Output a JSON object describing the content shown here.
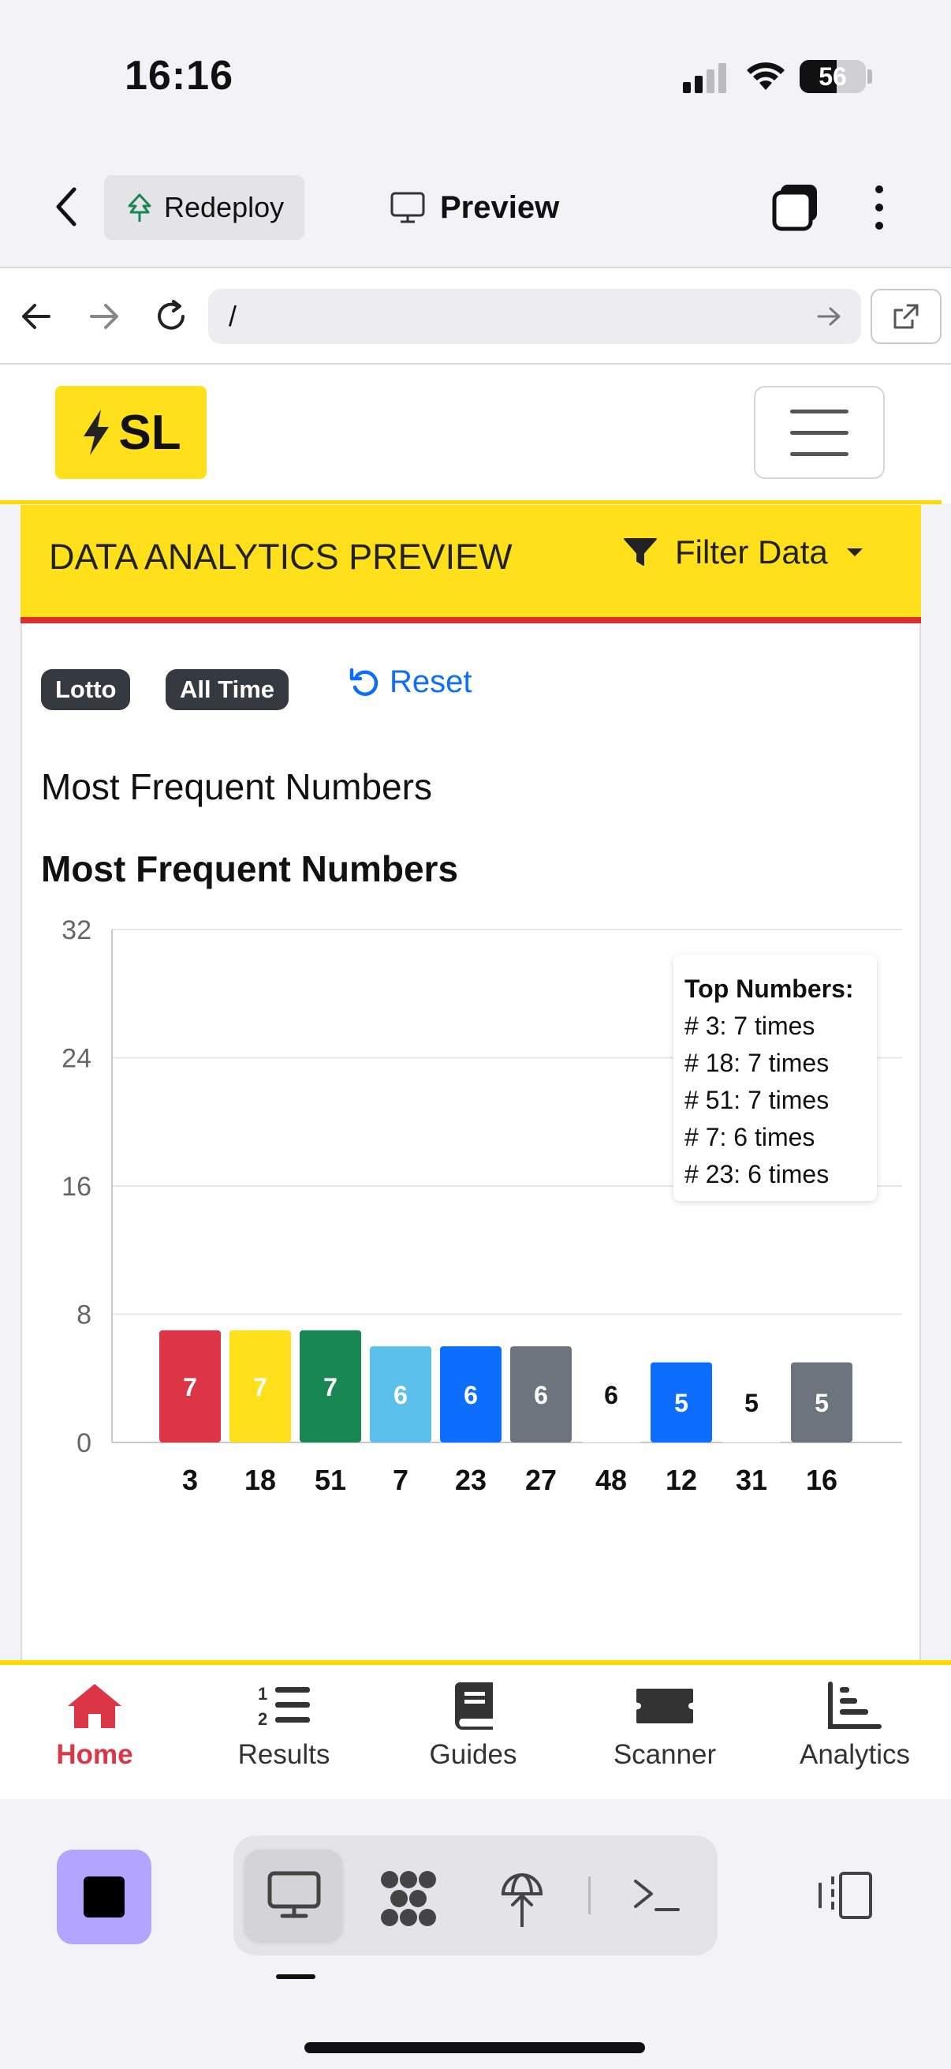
{
  "status_bar": {
    "time": "16:16",
    "battery": "56",
    "battery_level": 0.56
  },
  "replit_bar": {
    "redeploy_label": "Redeploy",
    "preview_label": "Preview"
  },
  "browser": {
    "url": "/"
  },
  "site": {
    "logo_text": "SL"
  },
  "card": {
    "title": "DATA ANALYTICS PREVIEW",
    "filter_label": "Filter Data",
    "badges": [
      "Lotto",
      "All Time"
    ],
    "reset_label": "Reset",
    "subtitle": "Most Frequent Numbers",
    "chart_heading": "Most Frequent Numbers"
  },
  "chart_data": {
    "type": "bar",
    "categories": [
      "3",
      "18",
      "51",
      "7",
      "23",
      "27",
      "48",
      "12",
      "31",
      "16"
    ],
    "values": [
      7,
      7,
      7,
      6,
      6,
      6,
      6,
      5,
      5,
      5
    ],
    "bar_colors": [
      "#dc3545",
      "#ffe01b",
      "#198754",
      "#5bc0eb",
      "#0d6efd",
      "#6c757d",
      "#ffffff",
      "#0d6efd",
      "#ffffff",
      "#6c757d"
    ],
    "label_colors": [
      "#ffffff",
      "#ffffff",
      "#ffffff",
      "#ffffff",
      "#ffffff",
      "#ffffff",
      "#111111",
      "#ffffff",
      "#111111",
      "#ffffff"
    ],
    "ylim": [
      0,
      32
    ],
    "yticks": [
      "0",
      "8",
      "16",
      "24",
      "32"
    ],
    "grid": true,
    "legend_box": {
      "title": "Top Numbers:",
      "lines": [
        "# 3: 7 times",
        "# 18: 7 times",
        "# 51: 7 times",
        "# 7: 6 times",
        "# 23: 6 times"
      ],
      "placement": "top-right"
    }
  },
  "tabs": [
    {
      "label": "Home",
      "icon": "home-icon",
      "active": true
    },
    {
      "label": "Results",
      "icon": "list-ol-icon",
      "active": false
    },
    {
      "label": "Guides",
      "icon": "book-icon",
      "active": false
    },
    {
      "label": "Scanner",
      "icon": "ticket-icon",
      "active": false
    },
    {
      "label": "Analytics",
      "icon": "chart-icon",
      "active": false
    }
  ]
}
